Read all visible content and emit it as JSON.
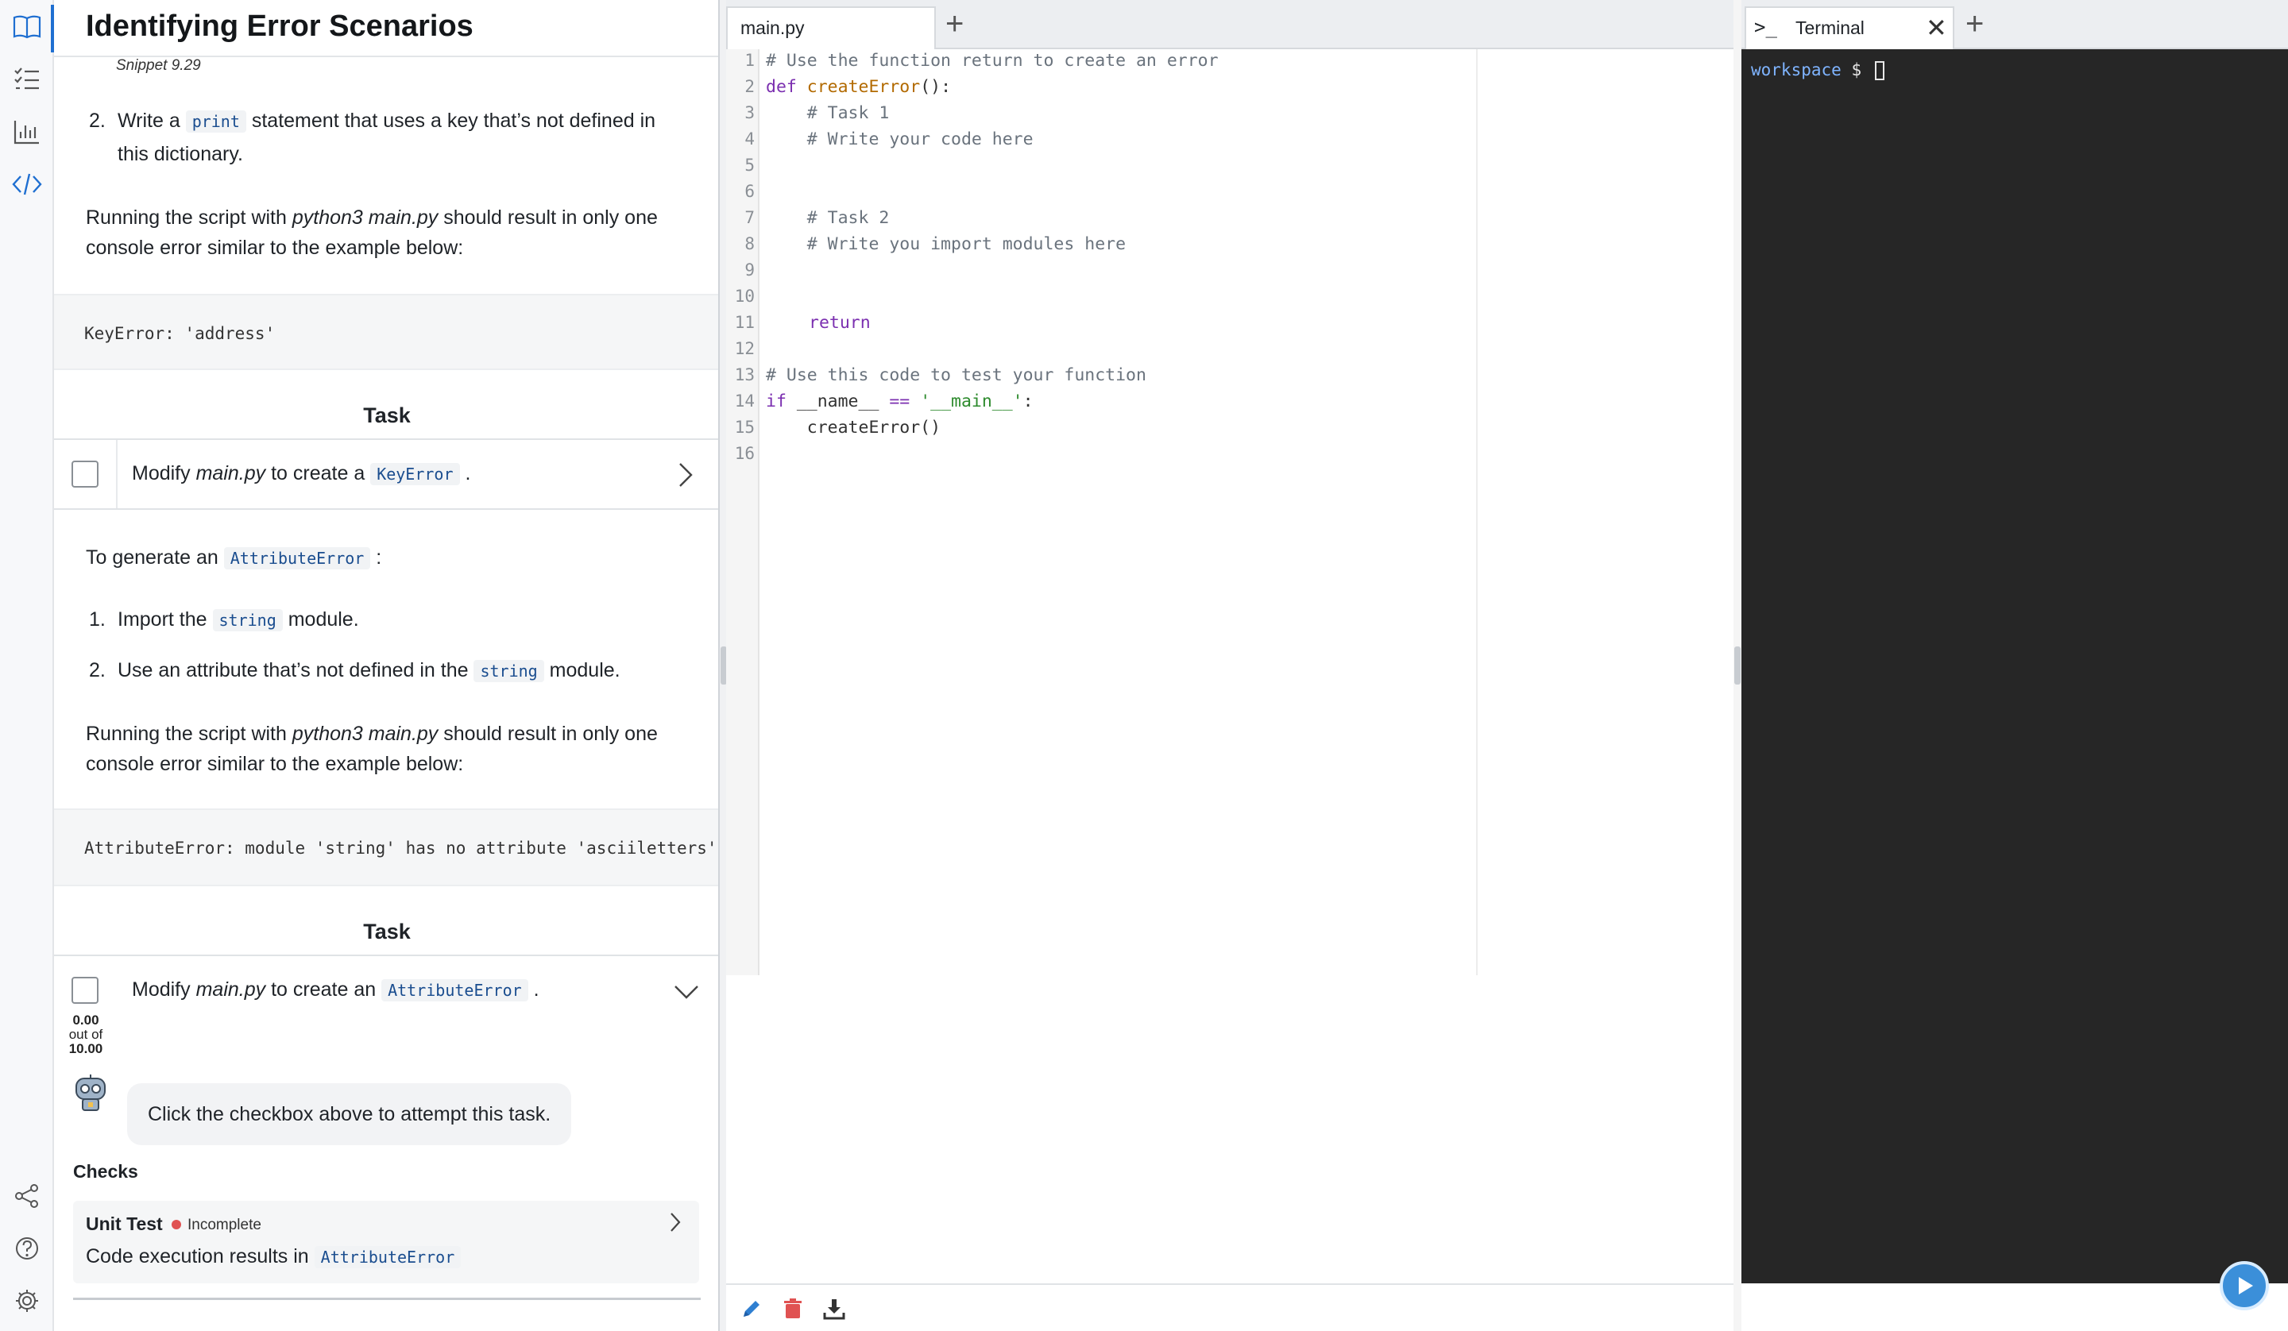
{
  "guide": {
    "title": "Identifying Error Scenarios",
    "snippet": "Snippet 9.29",
    "step2_pre": "Write a",
    "step2_code": "print",
    "step2_post_line1": "statement that uses a key that’s not defined in",
    "step2_post_line2": "this dictionary.",
    "running1_pre": "Running the script with",
    "running1_em": "python3 main.py",
    "running1_post": "should result in only one",
    "running1_line2": "console error similar to the example below:",
    "keyerror_example": "KeyError: 'address'",
    "task1_heading": "Task",
    "task1_pre": "Modify",
    "task1_em": "main.py",
    "task1_mid": "to create a",
    "task1_code": "KeyError",
    "task1_end": ".",
    "gen_pre": "To generate an",
    "gen_code": "AttributeError",
    "gen_end": ":",
    "item1_pre": "Import the",
    "item1_code": "string",
    "item1_post": "module.",
    "item2_pre": "Use an attribute that’s not defined in the",
    "item2_code": "string",
    "item2_post": "module.",
    "running2_pre": "Running the script with",
    "running2_em": "python3 main.py",
    "running2_post": "should result in only one",
    "running2_line2": "console error similar to the example below:",
    "attr_example": "AttributeError: module 'string' has no attribute 'asciiletters'",
    "task2_heading": "Task",
    "task2_pre": "Modify",
    "task2_em": "main.py",
    "task2_mid": "to create an",
    "task2_code": "AttributeError",
    "task2_end": ".",
    "score_value": "0.00",
    "score_out_of": "out of",
    "score_max": "10.00",
    "bot_message": "Click the checkbox above to attempt this task.",
    "checks_heading": "Checks",
    "check_title": "Unit Test",
    "check_status": "Incomplete",
    "check_desc_pre": "Code execution results in",
    "check_desc_code": "AttributeError",
    "list_num_2": "2.",
    "list_num_1b": "1.",
    "list_num_2b": "2."
  },
  "editor": {
    "tab_label": "main.py",
    "add_tab": "+",
    "lines": [
      {
        "n": "1"
      },
      {
        "n": "2"
      },
      {
        "n": "3"
      },
      {
        "n": "4"
      },
      {
        "n": "5"
      },
      {
        "n": "6"
      },
      {
        "n": "7"
      },
      {
        "n": "8"
      },
      {
        "n": "9"
      },
      {
        "n": "10"
      },
      {
        "n": "11"
      },
      {
        "n": "12"
      },
      {
        "n": "13"
      },
      {
        "n": "14"
      },
      {
        "n": "15"
      },
      {
        "n": "16"
      }
    ],
    "code": {
      "l1": "# Use the function return to create an error",
      "l2_kw": "def",
      "l2_fn": "createError",
      "l2_rest": "():",
      "l3": "    # Task 1",
      "l4": "    # Write your code here",
      "l7": "    # Task 2",
      "l8": "    # Write you import modules here",
      "l11": "return",
      "l13": "# Use this code to test your function",
      "l14_kw": "if",
      "l14_a": " __name__ ",
      "l14_op": "==",
      "l14_sp": " ",
      "l14_str": "'__main__'",
      "l14_end": ":",
      "l15": "    createError()"
    }
  },
  "terminal": {
    "tab_icon": ">_",
    "tab_label": "Terminal",
    "close": "✕",
    "add_tab": "+",
    "prompt_dir": "workspace",
    "prompt_sym": "$"
  },
  "colors": {
    "accent": "#1f6fd1",
    "terminal_bg": "#262626",
    "status_incomplete": "#e05252",
    "run_button": "#3b8fd9"
  }
}
